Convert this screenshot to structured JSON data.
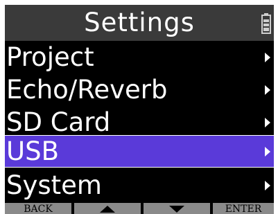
{
  "header": {
    "title": "Settings",
    "battery_icon": "battery-icon"
  },
  "menu": {
    "items": [
      {
        "label": "Project",
        "icon": "chevron-right-icon"
      },
      {
        "label": "Echo/Reverb",
        "icon": "chevron-right-icon"
      },
      {
        "label": "SD Card",
        "icon": "chevron-right-icon"
      },
      {
        "label": "USB",
        "icon": "chevron-right-icon",
        "selected": true
      },
      {
        "label": "System",
        "icon": "chevron-right-icon"
      }
    ],
    "selected_color": "#5a3ad9"
  },
  "footer": {
    "back_label": "BACK",
    "up_icon": "triangle-up-icon",
    "down_icon": "triangle-down-icon",
    "enter_label": "ENTER"
  },
  "colors": {
    "background": "#000000",
    "titlebar": "#3a3a3a",
    "text": "#ffffff",
    "footer_button": "#8a8a8a"
  }
}
